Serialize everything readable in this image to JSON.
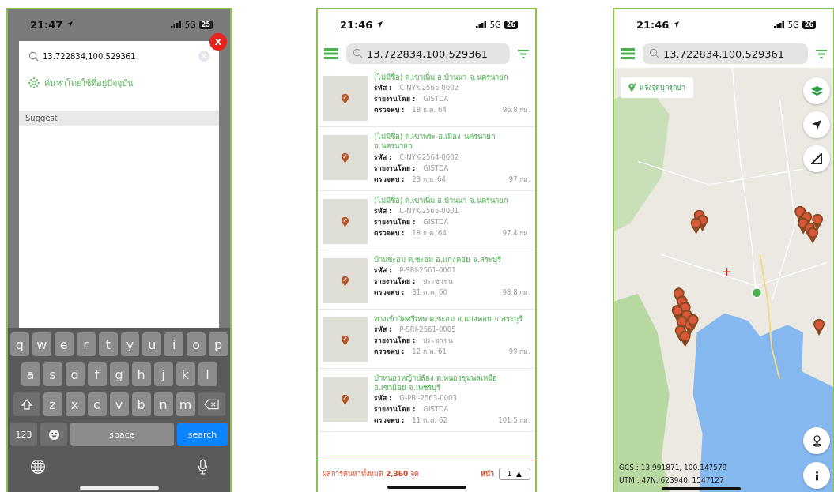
{
  "search_screen": {
    "status_bar": {
      "time": "21:47",
      "network": "5G",
      "battery": "25"
    },
    "close_button": "X",
    "search": {
      "value": "13.722834,100.529361"
    },
    "location_option": "ค้นหาโดยใช้ที่อยู่ปัจจุบัน",
    "section_header": "Suggest",
    "keyboard": {
      "rows": [
        [
          "q",
          "w",
          "e",
          "r",
          "t",
          "y",
          "u",
          "i",
          "o",
          "p"
        ],
        [
          "a",
          "s",
          "d",
          "f",
          "g",
          "h",
          "j",
          "k",
          "l"
        ],
        [
          "z",
          "x",
          "c",
          "v",
          "b",
          "n",
          "m"
        ]
      ],
      "numbers_key": "123",
      "space_key": "space",
      "search_key": "search"
    }
  },
  "list_screen": {
    "status_bar": {
      "time": "21:46",
      "network": "5G",
      "battery": "26"
    },
    "search": {
      "value": "13.722834,100.529361"
    },
    "results": [
      {
        "title": "(ไม่มีชื่อ) ต.เขาเพิ่ม อ.บ้านนา จ.นครนายก",
        "fields": [
          {
            "label": "รหัส :",
            "value": "C-NYK-2565-0002"
          },
          {
            "label": "รายงานโดย :",
            "value": "GISTDA"
          },
          {
            "label": "ตรวจพบ :",
            "value": "18 ธ.ค. 64"
          }
        ],
        "distance": "96.8 กม."
      },
      {
        "title": "(ไม่มีชื่อ) ต.เขาพระ อ.เมือง นครนายก จ.นครนายก",
        "fields": [
          {
            "label": "รหัส :",
            "value": "C-NYK-2564-0002"
          },
          {
            "label": "รายงานโดย :",
            "value": "GISTDA"
          },
          {
            "label": "ตรวจพบ :",
            "value": "23 ก.ย. 64"
          }
        ],
        "distance": "97 กม."
      },
      {
        "title": "(ไม่มีชื่อ) ต.เขาเพิ่ม อ.บ้านนา จ.นครนายก",
        "fields": [
          {
            "label": "รหัส :",
            "value": "C-NYK-2565-0001"
          },
          {
            "label": "รายงานโดย :",
            "value": "GISTDA"
          },
          {
            "label": "ตรวจพบ :",
            "value": "18 ธ.ค. 64"
          }
        ],
        "distance": "97.4 กม."
      },
      {
        "title": "บ้านชะอม ต.ชะอม อ.แก่งคอย จ.สระบุรี",
        "fields": [
          {
            "label": "รหัส :",
            "value": "P-SRI-2561-0001"
          },
          {
            "label": "รายงานโดย :",
            "value": "ประชาชน"
          },
          {
            "label": "ตรวจพบ :",
            "value": "31 ต.ค. 60"
          }
        ],
        "distance": "98.8 กม."
      },
      {
        "title": "ทางเข้าวัดศรีเทพ ต.ชะอม อ.แก่งคอย จ.สระบุรี",
        "fields": [
          {
            "label": "รหัส :",
            "value": "P-SRI-2561-0005"
          },
          {
            "label": "รายงานโดย :",
            "value": "ประชาชน"
          },
          {
            "label": "ตรวจพบ :",
            "value": "12 ก.พ. 61"
          }
        ],
        "distance": "99 กม."
      },
      {
        "title": "ป่าหนองหญ้าปล้อง ต.หนองชุมพลเหนือ อ.เขาย้อย จ.เพชรบุรี",
        "fields": [
          {
            "label": "รหัส :",
            "value": "G-PBI-2563-0003"
          },
          {
            "label": "รายงานโดย :",
            "value": "GISTDA"
          },
          {
            "label": "ตรวจพบ :",
            "value": "11 ต.ค. 62"
          }
        ],
        "distance": "101.5 กม."
      }
    ],
    "footer": {
      "summary": "ผลการค้นหาทั้งหมด **2,360** จุด",
      "page_label": "หน้า",
      "page": "1",
      "caret": "▲"
    }
  },
  "map_screen": {
    "status_bar": {
      "time": "21:46",
      "network": "5G",
      "battery": "26"
    },
    "search": {
      "value": "13.722834,100.529361"
    },
    "report_button": "แจ้งจุดบุกรุกป่า",
    "gcs": "GCS : 13.991871, 100.147579",
    "utm": "UTM : 47N, 623940, 1547127"
  }
}
